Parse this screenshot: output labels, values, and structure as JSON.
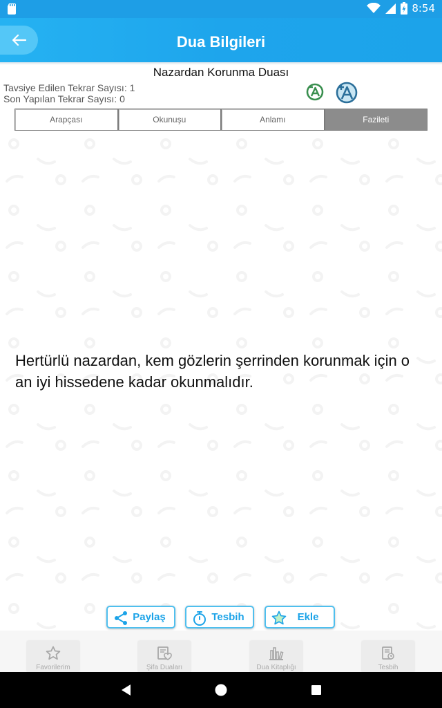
{
  "status_bar": {
    "time": "8:54"
  },
  "header": {
    "title": "Dua Bilgileri"
  },
  "dua": {
    "title": "Nazardan Korunma Duası",
    "recommended_count": "Tavsiye Edilen Tekrar Sayısı: 1",
    "last_count": "Son Yapılan Tekrar Sayısı: 0"
  },
  "tabs": [
    {
      "label": "Arapçası",
      "active": false
    },
    {
      "label": "Okunuşu",
      "active": false
    },
    {
      "label": "Anlamı",
      "active": false
    },
    {
      "label": "Fazileti",
      "active": true
    }
  ],
  "content": {
    "text": "Hertürlü nazardan, kem gözlerin şerrinden korunmak için o an iyi hissedene kadar okunmalıdır."
  },
  "actions": {
    "share": "Paylaş",
    "tesbih": "Tesbih",
    "add": "Ekle"
  },
  "bottom_nav": [
    {
      "label": "Favorilerim",
      "icon": "star-icon"
    },
    {
      "label": "Şifa Duaları",
      "icon": "heart-book-icon"
    },
    {
      "label": "Dua Kitaplığı",
      "icon": "bookshelf-icon"
    },
    {
      "label": "Tesbih",
      "icon": "tesbih-icon"
    }
  ],
  "colors": {
    "accent": "#1ea5ec",
    "active_tab": "#8c8c8c",
    "font_small_icon": "#3a8f4f",
    "font_large_icon": "#2b6f9a"
  }
}
